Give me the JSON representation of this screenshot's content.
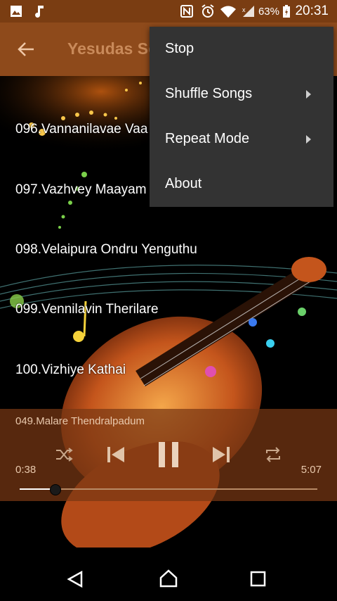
{
  "status_bar": {
    "battery": "63%",
    "time": "20:31",
    "icons": [
      "image-icon",
      "music-note-icon",
      "nfc-icon",
      "alarm-icon",
      "wifi-icon",
      "signal-icon",
      "battery-icon"
    ]
  },
  "app_bar": {
    "title": "Yesudas Songs",
    "back_icon": "arrow-left-icon"
  },
  "songs": [
    "096.Vannanilavae Vaa",
    "097.Vazhvey Maayam",
    "098.Velaipura Ondru Yenguthu",
    "099.Vennilavin Therilare",
    "100.Vizhiye Kathai"
  ],
  "player": {
    "now_playing": "049.Malare Thendralpadum",
    "current_time": "0:38",
    "total_time": "5:07",
    "progress": 0.12,
    "controls": [
      "shuffle-icon",
      "previous-icon",
      "pause-icon",
      "next-icon",
      "repeat-icon"
    ]
  },
  "menu": {
    "items": [
      {
        "label": "Stop",
        "submenu": false
      },
      {
        "label": "Shuffle Songs",
        "submenu": true
      },
      {
        "label": "Repeat Mode",
        "submenu": true
      },
      {
        "label": "About",
        "submenu": false
      }
    ]
  },
  "nav_bar": {
    "buttons": [
      "back-triangle-icon",
      "home-icon",
      "recents-icon"
    ]
  },
  "colors": {
    "status_bar": "#7a3d12",
    "app_bar": "#8e4a1b",
    "menu_bg": "#333333",
    "player_bg": "#78371488"
  }
}
